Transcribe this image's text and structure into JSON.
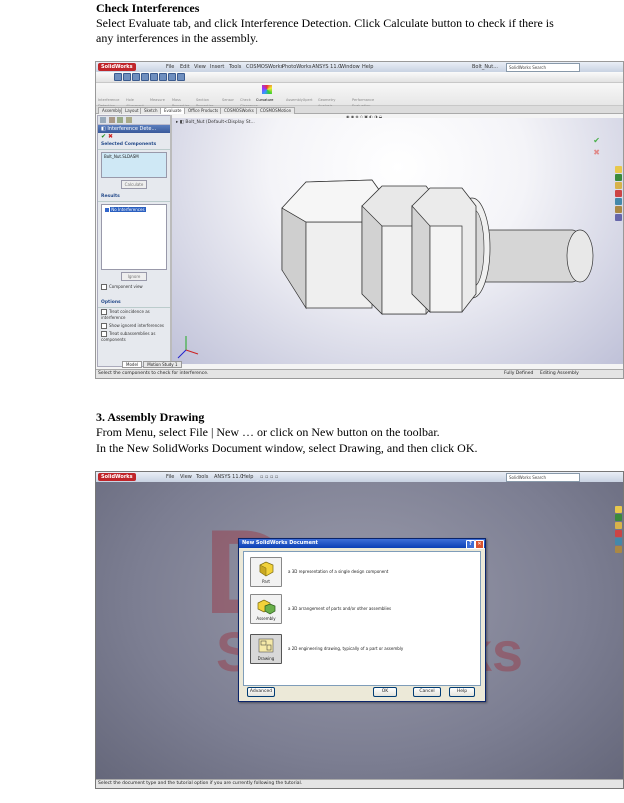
{
  "section1": {
    "heading": "Check Interferences",
    "line1": "Select Evaluate tab, and click Interference Detection. Click Calculate button to check if there is",
    "line2": "any interferences in the assembly."
  },
  "shot1": {
    "app_logo": "SolidWorks",
    "menu": [
      "File",
      "Edit",
      "View",
      "Insert",
      "Tools",
      "COSMOSWorks",
      "PhotoWorks",
      "ANSYS 11.0",
      "Window",
      "Help"
    ],
    "doc_name": "Bolt_Nut...",
    "search_placeholder": "SolidWorks Search",
    "ribbon": [
      "Interference Detection",
      "Hole Alignment",
      "Measure",
      "Mass Properties",
      "Section Properties",
      "Sensor",
      "Check Clearance",
      "Curvature",
      "AssemblyXpert",
      "Geometry Analysis",
      "Performance Evaluation"
    ],
    "tabs": [
      "Assembly",
      "Layout",
      "Sketch",
      "Evaluate",
      "Office Products",
      "COSMOSWorks",
      "COSMOSMotion"
    ],
    "active_tab": "Evaluate",
    "tree_label": "Bolt_Nut (Default<Display St...",
    "panel_title": "Interference Dete...",
    "selected_components_label": "Selected Components",
    "selected_item": "Bolt_Nut.SLDASM",
    "calculate_label": "Calculate",
    "results_label": "Results",
    "result_item": "No Interferences",
    "ignore_label": "Ignore",
    "component_view": "Component view",
    "options_label": "Options",
    "options": [
      "Treat coincidence as interference",
      "Show ignored interferences",
      "Treat subassemblies as components"
    ],
    "bottom_tabs": [
      "Model",
      "Motion Study 1"
    ],
    "status_left": "Select the components to check for interference.",
    "status_mid": "Fully Defined",
    "status_right": "Editing Assembly"
  },
  "section2": {
    "heading": "3. Assembly Drawing",
    "line1": "From Menu, select File | New … or click on New button on the toolbar.",
    "line2": "In the New SolidWorks Document window, select Drawing, and then click OK."
  },
  "shot2": {
    "app_logo": "SolidWorks",
    "menu": [
      "File",
      "View",
      "Tools",
      "ANSYS 11.0",
      "Help"
    ],
    "search_placeholder": "SolidWorks Search",
    "dialog_title": "New SolidWorks Document",
    "docs": [
      {
        "label": "Part",
        "desc": "a 3D representation of a single design component"
      },
      {
        "label": "Assembly",
        "desc": "a 3D arrangement of parts and/or other assemblies"
      },
      {
        "label": "Drawing",
        "desc": "a 2D engineering drawing, typically of a part or assembly"
      }
    ],
    "advanced_label": "Advanced",
    "ok_label": "OK",
    "cancel_label": "Cancel",
    "help_label": "Help",
    "status_left": "Select the document type and the tutorial option if you are currently following the tutorial."
  }
}
